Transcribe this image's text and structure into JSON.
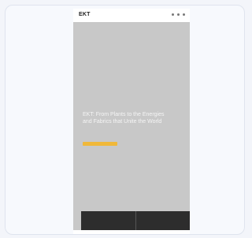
{
  "brand": {
    "logo": "EKT",
    "subtitle": ""
  },
  "hero": {
    "headline": "EKT: From Plants to the Energies and Fabrics that Unite the World",
    "cta_label": ""
  },
  "panel": {
    "tiles": [
      {
        "title": "",
        "desc": ""
      },
      {
        "title": "",
        "desc": ""
      }
    ]
  },
  "footer": {
    "text": "",
    "link": ""
  },
  "colors": {
    "accent": "#f0b83a",
    "hero_bg": "#c8c8c8",
    "panel_bg": "#2d2d2d"
  }
}
